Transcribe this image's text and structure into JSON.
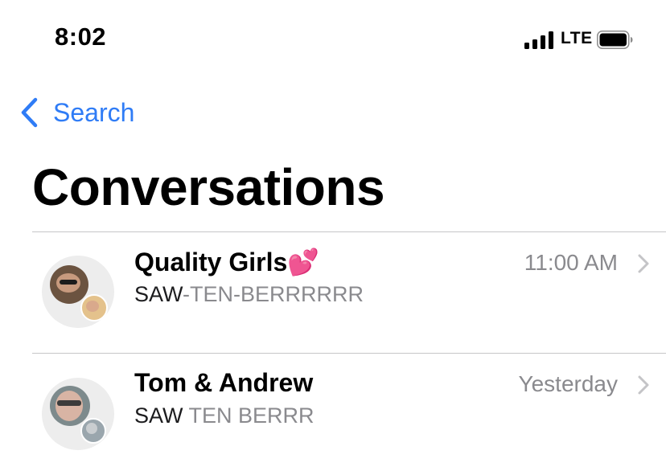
{
  "status_bar": {
    "time": "8:02",
    "network": "LTE",
    "signal_bars": 4
  },
  "nav": {
    "back_label": "Search",
    "accent_color": "#2f7cf6"
  },
  "page": {
    "title": "Conversations"
  },
  "conversations": [
    {
      "title": "Quality Girls💕",
      "subtitle_sender": "SAW",
      "subtitle_rest": "-TEN-BERRRRRR",
      "time": "11:00 AM"
    },
    {
      "title": "Tom & Andrew",
      "subtitle_sender": "SAW",
      "subtitle_rest": " TEN BERRR",
      "time": "Yesterday"
    }
  ]
}
